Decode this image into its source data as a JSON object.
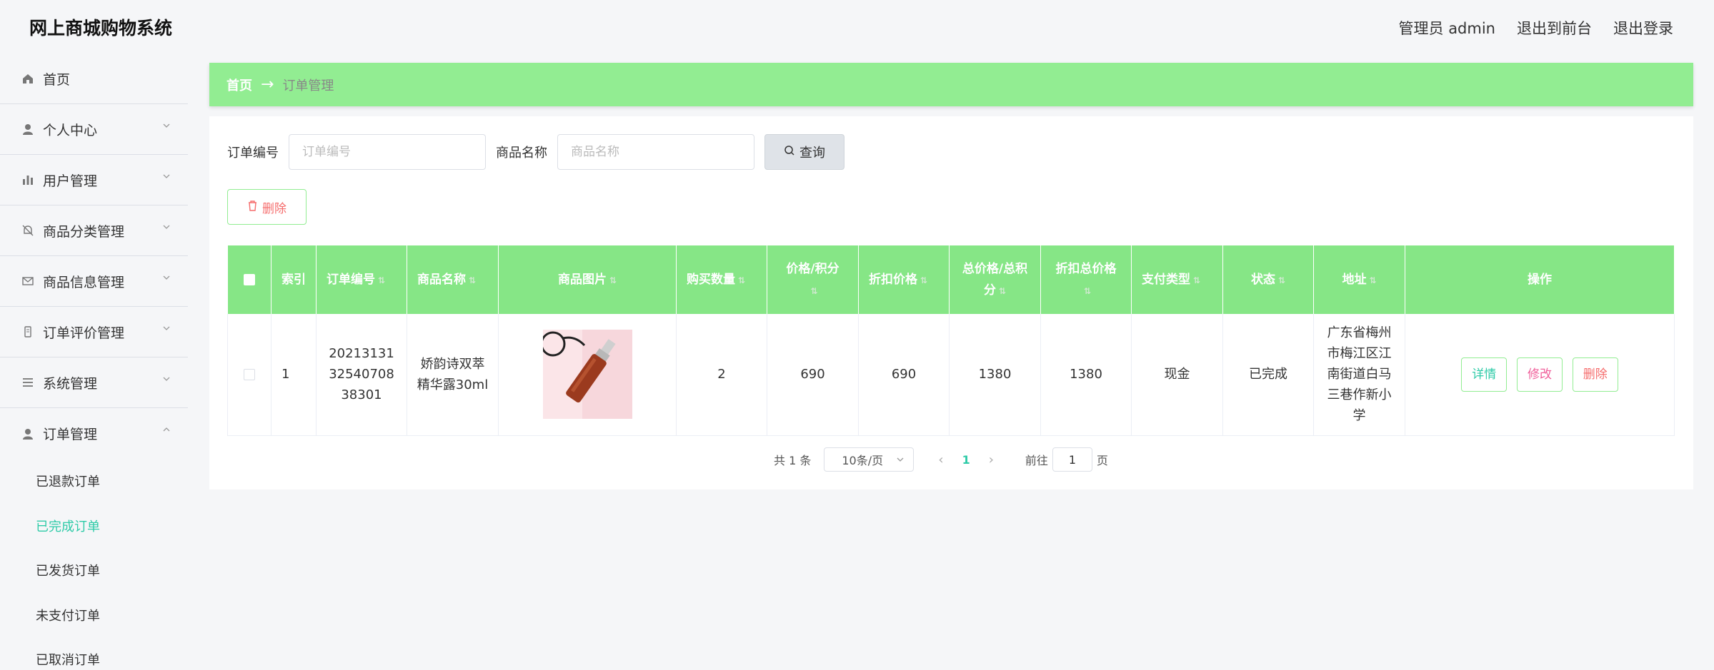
{
  "header": {
    "app_title": "网上商城购物系统",
    "admin_label": "管理员 admin",
    "back_to_front": "退出到前台",
    "logout": "退出登录"
  },
  "sidebar": {
    "items": [
      {
        "label": "首页",
        "icon": "home-icon"
      },
      {
        "label": "个人中心",
        "icon": "user-icon"
      },
      {
        "label": "用户管理",
        "icon": "chart-bar-icon"
      },
      {
        "label": "商品分类管理",
        "icon": "bell-off-icon"
      },
      {
        "label": "商品信息管理",
        "icon": "mail-icon"
      },
      {
        "label": "订单评价管理",
        "icon": "tablet-icon"
      },
      {
        "label": "系统管理",
        "icon": "list-icon"
      },
      {
        "label": "订单管理",
        "icon": "user-icon"
      }
    ],
    "sub_items": [
      {
        "label": "已退款订单"
      },
      {
        "label": "已完成订单"
      },
      {
        "label": "已发货订单"
      },
      {
        "label": "未支付订单"
      },
      {
        "label": "已取消订单"
      }
    ]
  },
  "breadcrumb": {
    "home": "首页",
    "separator": "→",
    "current": "订单管理"
  },
  "search": {
    "order_no_label": "订单编号",
    "order_no_placeholder": "订单编号",
    "product_name_label": "商品名称",
    "product_name_placeholder": "商品名称",
    "query_button": "查询"
  },
  "toolbar": {
    "delete_label": "删除"
  },
  "table": {
    "headers": [
      "索引",
      "订单编号",
      "商品名称",
      "商品图片",
      "购买数量",
      "价格/积分",
      "折扣价格",
      "总价格/总积分",
      "折扣总价格",
      "支付类型",
      "状态",
      "地址",
      "操作"
    ],
    "rows": [
      {
        "index": "1",
        "order_no": "202131313254070838301",
        "product_name": "娇韵诗双萃精华露30ml",
        "quantity": "2",
        "price": "690",
        "discount_price": "690",
        "total_price": "1380",
        "discount_total": "1380",
        "pay_type": "现金",
        "status": "已完成",
        "address": "广东省梅州市梅江区江南街道白马三巷作新小学",
        "actions": {
          "detail": "详情",
          "edit": "修改",
          "delete": "删除"
        }
      }
    ]
  },
  "pagination": {
    "total": "共 1 条",
    "page_size": "10条/页",
    "current_page": "1",
    "goto_label": "前往",
    "goto_value": "1",
    "page_suffix": "页"
  },
  "colors": {
    "accent_green": "#92ed92",
    "header_green": "#86e686",
    "active_teal": "#2fcba8",
    "danger": "#f56c6c"
  }
}
